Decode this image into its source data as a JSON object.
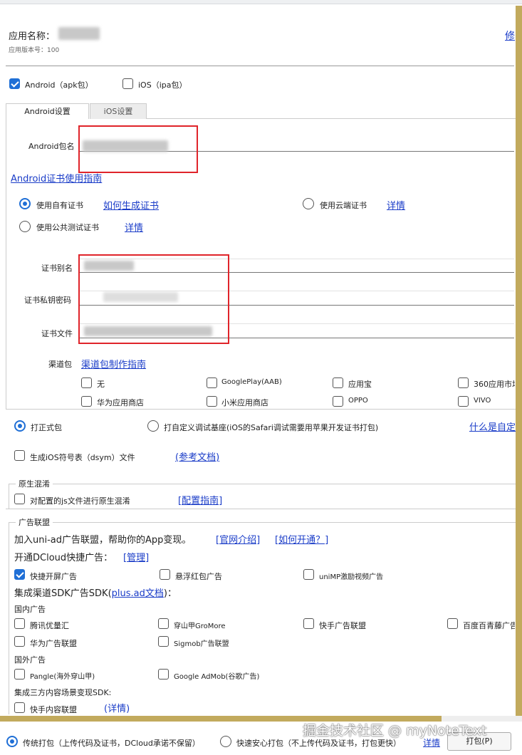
{
  "app": {
    "name_label": "应用名称：",
    "version_label": "应用版本号：100",
    "edit_link": "修"
  },
  "platforms": {
    "android": "Android（apk包）",
    "ios": "iOS（ipa包）"
  },
  "tabs": [
    "Android设置",
    "iOS设置"
  ],
  "android": {
    "package_label": "Android包名",
    "cert_guide": "Android证书使用指南",
    "own_cert": "使用自有证书",
    "how_gen": "如何生成证书",
    "cloud_cert": "使用云端证书",
    "details": "详情",
    "public_cert": "使用公共测试证书",
    "alias_label": "证书别名",
    "password_label": "证书私钥密码",
    "file_label": "证书文件",
    "channel_label": "渠道包",
    "channel_guide": "渠道包制作指南",
    "channels": [
      "无",
      "GooglePlay(AAB)",
      "应用宝",
      "360应用市场",
      "华为应用商店",
      "小米应用商店",
      "OPPO",
      "VIVO"
    ]
  },
  "build": {
    "release": "打正式包",
    "custom_base": "打自定义调试基座(iOS的Safari调试需要用苹果开发证书打包)",
    "what_custom": "什么是自定",
    "dsym": "生成iOS符号表（dsym）文件",
    "ref_doc": "(参考文档)"
  },
  "obfuscation": {
    "title": "原生混淆",
    "js_option": "对配置的js文件进行原生混淆",
    "config_guide": "[配置指南]"
  },
  "ads": {
    "title": "广告联盟",
    "join_text": "加入uni-ad广告联盟，帮助你的App变现。",
    "official_intro": "[官网介绍]",
    "how_open": "[如何开通？]",
    "quick_ad": "开通DCloud快捷广告：",
    "manage": "[管理]",
    "splash": "快捷开屏广告",
    "float": "悬浮红包广告",
    "video": "uniMP激励视频广告",
    "sdk_text": "集成渠道SDK广告SDK(",
    "sdk_link": "plus.ad文档",
    "sdk_tail": ")：",
    "domestic": "国内广告",
    "domestic_items": [
      "腾讯优量汇",
      "穿山甲GroMore",
      "快手广告联盟",
      "百度百青藤广告",
      "华为广告联盟",
      "Sigmob广告联盟"
    ],
    "overseas": "国外广告",
    "overseas_items": [
      "Pangle(海外穿山甲)",
      "Google AdMob(谷歌广告)"
    ],
    "third_party": "集成三方内容场景变现SDK:",
    "kuaishou_content": "快手内容联盟",
    "details": "(详情)"
  },
  "footer": {
    "traditional": "传统打包（上传代码及证书，DCloud承诺不保留）",
    "fast": "快速安心打包（不上传代码及证书，打包更快）",
    "details": "详情",
    "pack_button": "打包(P)",
    "watermark": "掘金技术社区 @ myNoteText"
  }
}
